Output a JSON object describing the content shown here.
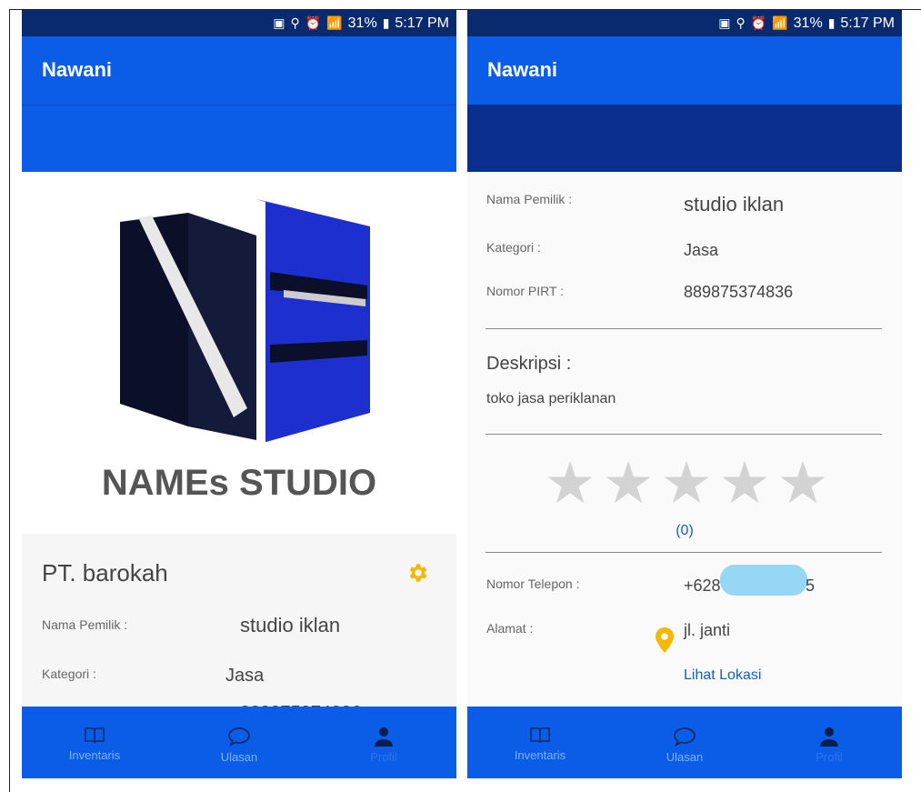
{
  "status_bar": {
    "battery": "31%",
    "time": "5:17 PM"
  },
  "app": {
    "title": "Nawani"
  },
  "logo": {
    "text": "NAMEs STUDIO"
  },
  "shop": {
    "name": "PT. barokah",
    "owner_label": "Nama Pemilik :",
    "owner_value": "studio iklan",
    "category_label": "Kategori :",
    "category_value": "Jasa",
    "pirt_label": "Nomor PIRT :",
    "pirt_value": "889875374836",
    "description_label": "Deskripsi :",
    "description_value": "toko jasa periklanan",
    "rating": 0,
    "rating_count": "(0)",
    "phone_label": "Nomor Telepon :",
    "phone_prefix": "+628",
    "phone_suffix": "5",
    "address_label": "Alamat :",
    "address_value": "jl. janti",
    "location_link": "Lihat Lokasi"
  },
  "nav": {
    "items": [
      {
        "label": "Inventaris",
        "icon": "book-icon"
      },
      {
        "label": "Ulasan",
        "icon": "chat-bubble-icon"
      },
      {
        "label": "Profil",
        "icon": "person-icon"
      }
    ]
  },
  "colors": {
    "primary": "#0b5ce6",
    "status_bar": "#0a2a6e",
    "header_dark": "#0a2f8f",
    "accent": "#f5b800",
    "link": "#1a5fb4"
  }
}
